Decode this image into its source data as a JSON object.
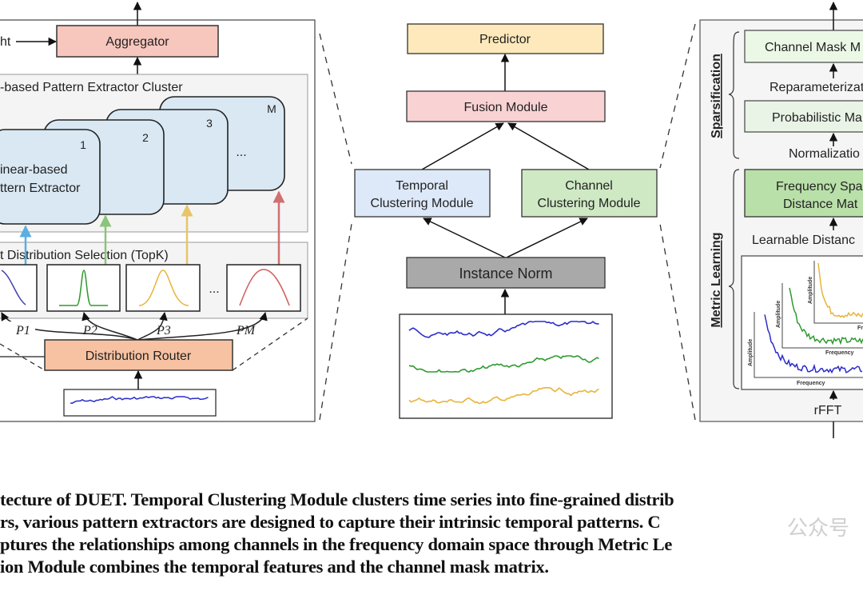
{
  "left_panel": {
    "input_label_fragment": "ht",
    "aggregator": "Aggregator",
    "cluster_title": "-based Pattern Extractor Cluster",
    "extractor_label_line1": "inear-based",
    "extractor_label_line2": "ttern Extractor",
    "card_indices": [
      "1",
      "2",
      "3",
      "M"
    ],
    "ellipsis": "...",
    "selection_title": "t Distribution Selection (TopK)",
    "probabilities": [
      "P1",
      "P2",
      "P3",
      "PM"
    ],
    "router": "Distribution Router"
  },
  "center_panel": {
    "predictor": "Predictor",
    "fusion": "Fusion Module",
    "temporal_line1": "Temporal",
    "temporal_line2": "Clustering Module",
    "channel_line1": "Channel",
    "channel_line2": "Clustering Module",
    "instance_norm": "Instance Norm"
  },
  "right_panel": {
    "sparsification": "Sparsification",
    "metric_learning": "Metric  Learning",
    "channel_mask": "Channel Mask M",
    "reparameterization": "Reparameterizati",
    "probabilistic": "Probabilistic Ma",
    "normalization": "Normalizatio",
    "freq_line1": "Frequency Spa",
    "freq_line2": "Distance Mat",
    "learnable_distance": "Learnable Distanc",
    "amplitude": "Amplitude",
    "frequency": "Frequency",
    "frequency_cut": "Fr",
    "rfft": "rFFT"
  },
  "colors": {
    "aggregator": "#f7c6bd",
    "router": "#f7c2a2",
    "extractor": "#d9e8f3",
    "predictor": "#fde9bb",
    "fusion": "#f9d2d4",
    "temporal": "#dde8f8",
    "channel": "#cfe9c4",
    "instance_norm": "#a9a9a9",
    "freq_matrix": "#b9e0a9",
    "mask": "#ecf8e6",
    "blue": "#2b2bcc",
    "green": "#2e9a2e",
    "yellow": "#e8b43a",
    "red": "#d05c5c"
  },
  "caption": {
    "line1": "tecture of DUET. Temporal Clustering Module clusters time series into fine-grained distrib",
    "line2": "rs, various pattern extractors are designed to capture their intrinsic temporal patterns. C",
    "line3": "ptures the relationships among channels in the frequency domain space through Metric Le",
    "line4": "ion Module combines the temporal features and the channel mask matrix."
  },
  "watermark": "公众号"
}
